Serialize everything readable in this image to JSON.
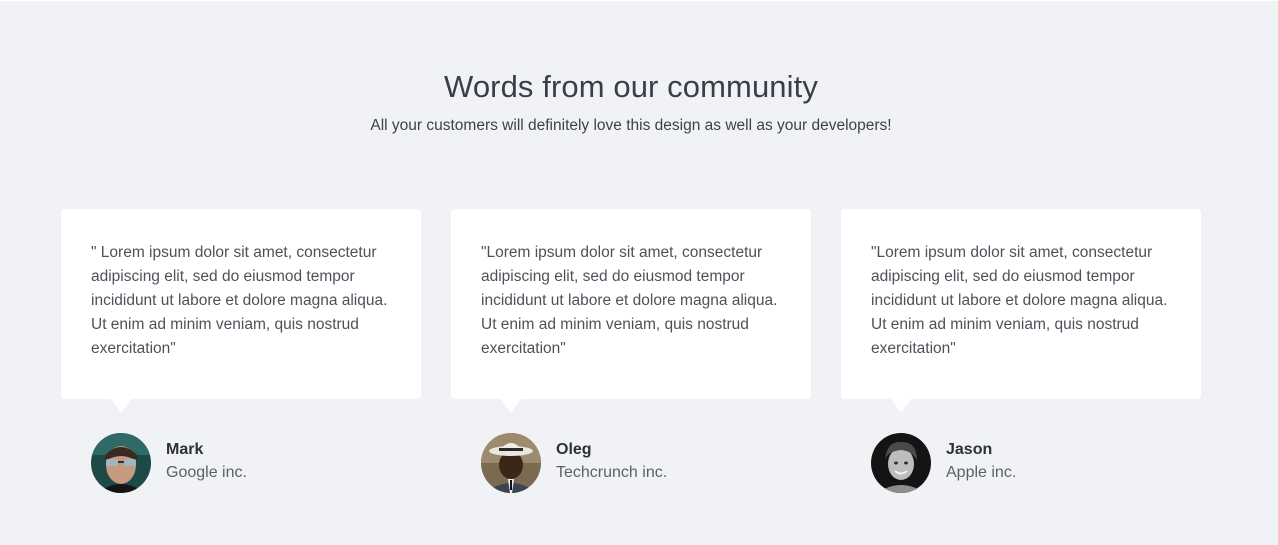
{
  "section": {
    "title": "Words from our community",
    "subtitle": "All your customers will definitely love this design as well as your developers!"
  },
  "testimonials": [
    {
      "quote": "\" Lorem ipsum dolor sit amet, consectetur adipiscing elit, sed do eiusmod tempor incididunt ut labore et dolore magna aliqua. Ut enim ad minim veniam, quis nostrud exercitation\"",
      "name": "Mark",
      "company": "Google inc.",
      "avatar_icon": "person-sunglasses-avatar"
    },
    {
      "quote": "\"Lorem ipsum dolor sit amet, consectetur adipiscing elit, sed do eiusmod tempor incididunt ut labore et dolore magna aliqua. Ut enim ad minim veniam, quis nostrud exercitation\"",
      "name": "Oleg",
      "company": "Techcrunch inc.",
      "avatar_icon": "person-hat-avatar"
    },
    {
      "quote": "\"Lorem ipsum dolor sit amet, consectetur adipiscing elit, sed do eiusmod tempor incididunt ut labore et dolore magna aliqua. Ut enim ad minim veniam, quis nostrud exercitation\"",
      "name": "Jason",
      "company": "Apple inc.",
      "avatar_icon": "person-smiling-avatar"
    }
  ],
  "colors": {
    "background": "#f1f2f6",
    "card": "#ffffff",
    "heading": "#3b3e48",
    "quote_text": "#4e515a"
  }
}
